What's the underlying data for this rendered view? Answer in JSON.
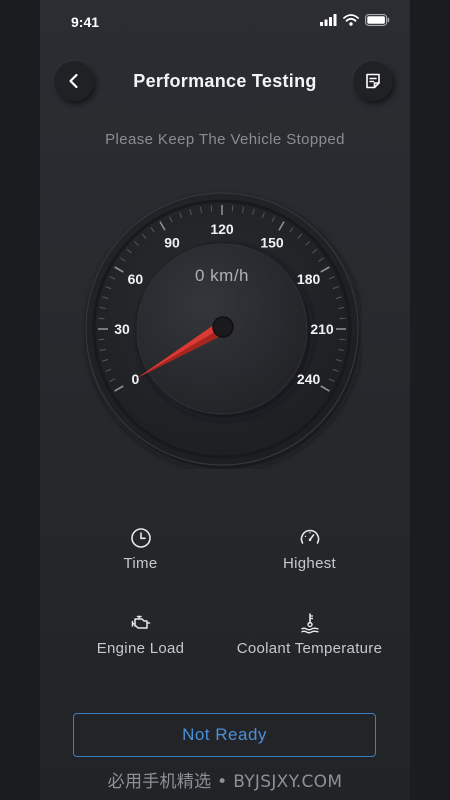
{
  "status_bar": {
    "time": "9:41"
  },
  "header": {
    "title": "Performance Testing"
  },
  "notice": "Please Keep The Vehicle Stopped",
  "gauge": {
    "speed_display": "0 km/h",
    "tick_labels": [
      "0",
      "30",
      "60",
      "90",
      "120",
      "150",
      "180",
      "210",
      "240"
    ],
    "current_speed": 0,
    "max_speed": 240,
    "needle_color": "#d93a34"
  },
  "stats": {
    "time": {
      "label": "Time",
      "icon": "clock-icon"
    },
    "highest": {
      "label": "Highest",
      "icon": "speedometer-icon"
    },
    "engine_load": {
      "label": "Engine Load",
      "icon": "engine-icon"
    },
    "coolant": {
      "label": "Coolant Temperature",
      "icon": "coolant-temperature-icon"
    }
  },
  "action": {
    "label": "Not Ready",
    "accent": "#4a90d8"
  },
  "watermark": "必用手机精选 • BYJSJXY.COM"
}
